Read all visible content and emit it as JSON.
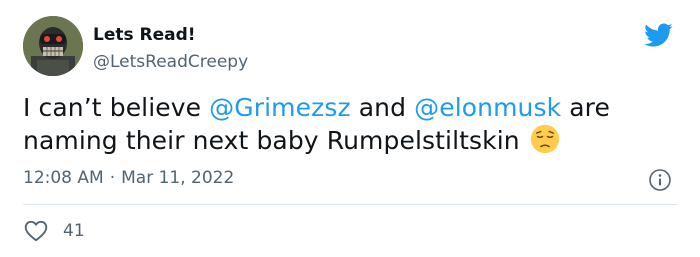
{
  "author": {
    "display_name": "Lets Read!",
    "handle": "@LetsReadCreepy",
    "avatar_icon": "avatar-image"
  },
  "tweet": {
    "text_part1": "I can’t believe ",
    "mention1": "@Grimezsz",
    "text_part2": " and ",
    "mention2": "@elonmusk",
    "text_part3": " are naming their next baby Rumpelstiltskin",
    "emoji_icon": "pensive-face-emoji"
  },
  "meta": {
    "time": "12:08 AM",
    "separator": "·",
    "date": "Mar 11, 2022"
  },
  "actions": {
    "like_count": "41"
  },
  "colors": {
    "mention": "#1d9bf0",
    "twitter_blue": "#1d9bf0",
    "muted": "#536471"
  }
}
